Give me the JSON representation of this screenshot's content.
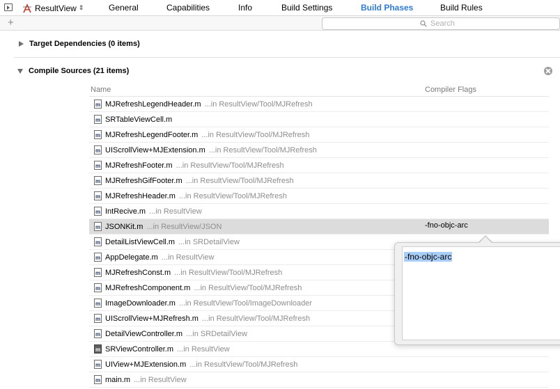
{
  "toolbar": {
    "target_name": "ResultView",
    "tabs": [
      {
        "label": "General"
      },
      {
        "label": "Capabilities"
      },
      {
        "label": "Info"
      },
      {
        "label": "Build Settings"
      },
      {
        "label": "Build Phases",
        "active": true
      },
      {
        "label": "Build Rules"
      }
    ]
  },
  "filter": {
    "add_label": "+",
    "search_placeholder": "Search"
  },
  "target_dependencies": {
    "title": "Target Dependencies (0 items)",
    "expanded": false
  },
  "compile_sources": {
    "title": "Compile Sources (21 items)",
    "expanded": true,
    "columns": {
      "name": "Name",
      "flags": "Compiler Flags"
    },
    "files": [
      {
        "name": "MJRefreshLegendHeader.m",
        "path": "...in ResultView/Tool/MJRefresh",
        "flags": ""
      },
      {
        "name": "SRTableViewCell.m",
        "path": "",
        "flags": ""
      },
      {
        "name": "MJRefreshLegendFooter.m",
        "path": "...in ResultView/Tool/MJRefresh",
        "flags": ""
      },
      {
        "name": "UIScrollView+MJExtension.m",
        "path": "...in ResultView/Tool/MJRefresh",
        "flags": ""
      },
      {
        "name": "MJRefreshFooter.m",
        "path": "...in ResultView/Tool/MJRefresh",
        "flags": ""
      },
      {
        "name": "MJRefreshGifFooter.m",
        "path": "...in ResultView/Tool/MJRefresh",
        "flags": ""
      },
      {
        "name": "MJRefreshHeader.m",
        "path": "...in ResultView/Tool/MJRefresh",
        "flags": ""
      },
      {
        "name": "IntRecive.m",
        "path": "...in ResultView",
        "flags": ""
      },
      {
        "name": "JSONKit.m",
        "path": "...in ResultView/JSON",
        "flags": "-fno-objc-arc",
        "selected": true
      },
      {
        "name": "DetailListViewCell.m",
        "path": "...in SRDetailView",
        "flags": ""
      },
      {
        "name": "AppDelegate.m",
        "path": "...in ResultView",
        "flags": ""
      },
      {
        "name": "MJRefreshConst.m",
        "path": "...in ResultView/Tool/MJRefresh",
        "flags": ""
      },
      {
        "name": "MJRefreshComponent.m",
        "path": "...in ResultView/Tool/MJRefresh",
        "flags": ""
      },
      {
        "name": "ImageDownloader.m",
        "path": "...in ResultView/Tool/ImageDownloader",
        "flags": ""
      },
      {
        "name": "UIScrollView+MJRefresh.m",
        "path": "...in ResultView/Tool/MJRefresh",
        "flags": ""
      },
      {
        "name": "DetailViewController.m",
        "path": "...in SRDetailView",
        "flags": ""
      },
      {
        "name": "SRViewController.m",
        "path": "...in ResultView",
        "flags": "",
        "icon_dark": true
      },
      {
        "name": "UIView+MJExtension.m",
        "path": "...in ResultView/Tool/MJRefresh",
        "flags": ""
      },
      {
        "name": "main.m",
        "path": "...in ResultView",
        "flags": ""
      }
    ]
  },
  "flags_editor": {
    "value": "-fno-objc-arc"
  },
  "colors": {
    "active_tab": "#2e7bd6",
    "selected_row": "#dcdcdc",
    "text_selection": "#a8cdf7"
  }
}
